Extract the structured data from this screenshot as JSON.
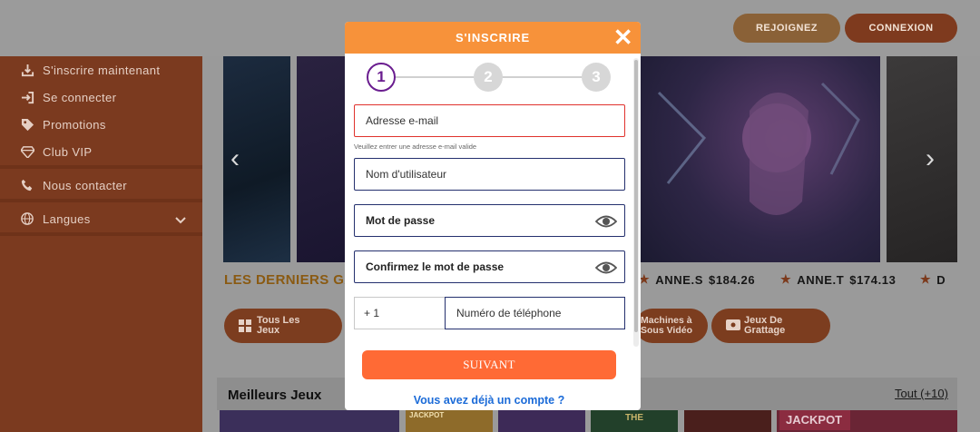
{
  "header": {
    "join_label": "REJOIGNEZ",
    "login_label": "CONNEXION"
  },
  "sidebar": {
    "items": [
      {
        "label": "S'inscrire maintenant",
        "icon": "register-icon"
      },
      {
        "label": "Se connecter",
        "icon": "login-icon"
      },
      {
        "label": "Promotions",
        "icon": "tag-icon"
      },
      {
        "label": "Club VIP",
        "icon": "diamond-icon"
      },
      {
        "label": "Nous contacter",
        "icon": "phone-icon"
      },
      {
        "label": "Langues",
        "icon": "globe-icon"
      }
    ]
  },
  "ticker": {
    "title": "LES DERNIERS GA",
    "entries": [
      {
        "name": "ANNE.S",
        "amount": "$184.26"
      },
      {
        "name": "ANNE.T",
        "amount": "$174.13"
      },
      {
        "name": "D",
        "amount": ""
      }
    ]
  },
  "categories": [
    {
      "label": "Tous Les Jeux"
    },
    {
      "label": "Machines à Sous Vidéo"
    },
    {
      "label": "Jeux De Grattage"
    }
  ],
  "best": {
    "title": "Meilleurs Jeux",
    "all_label": "Tout (+10)",
    "thumb_labels": [
      "JACKPOT",
      "THE",
      "JACKPOT"
    ]
  },
  "modal": {
    "title": "S'INSCRIRE",
    "steps": [
      "1",
      "2",
      "3"
    ],
    "email_placeholder": "Adresse e-mail",
    "email_error": "Veuillez entrer une adresse e-mail valide",
    "username_placeholder": "Nom d'utilisateur",
    "password_placeholder": "Mot de passe",
    "confirm_placeholder": "Confirmez le mot de passe",
    "phone_prefix": "+ 1",
    "phone_placeholder": "Numéro de téléphone",
    "submit_label": "SUIVANT",
    "have_account_label": "Vous avez déjà un compte ?"
  },
  "colors": {
    "modal_header": "#f7923a",
    "submit": "#ff6a35",
    "step_active": "#6a1d8f",
    "error_border": "#e0322d",
    "link": "#1b6bd8"
  }
}
